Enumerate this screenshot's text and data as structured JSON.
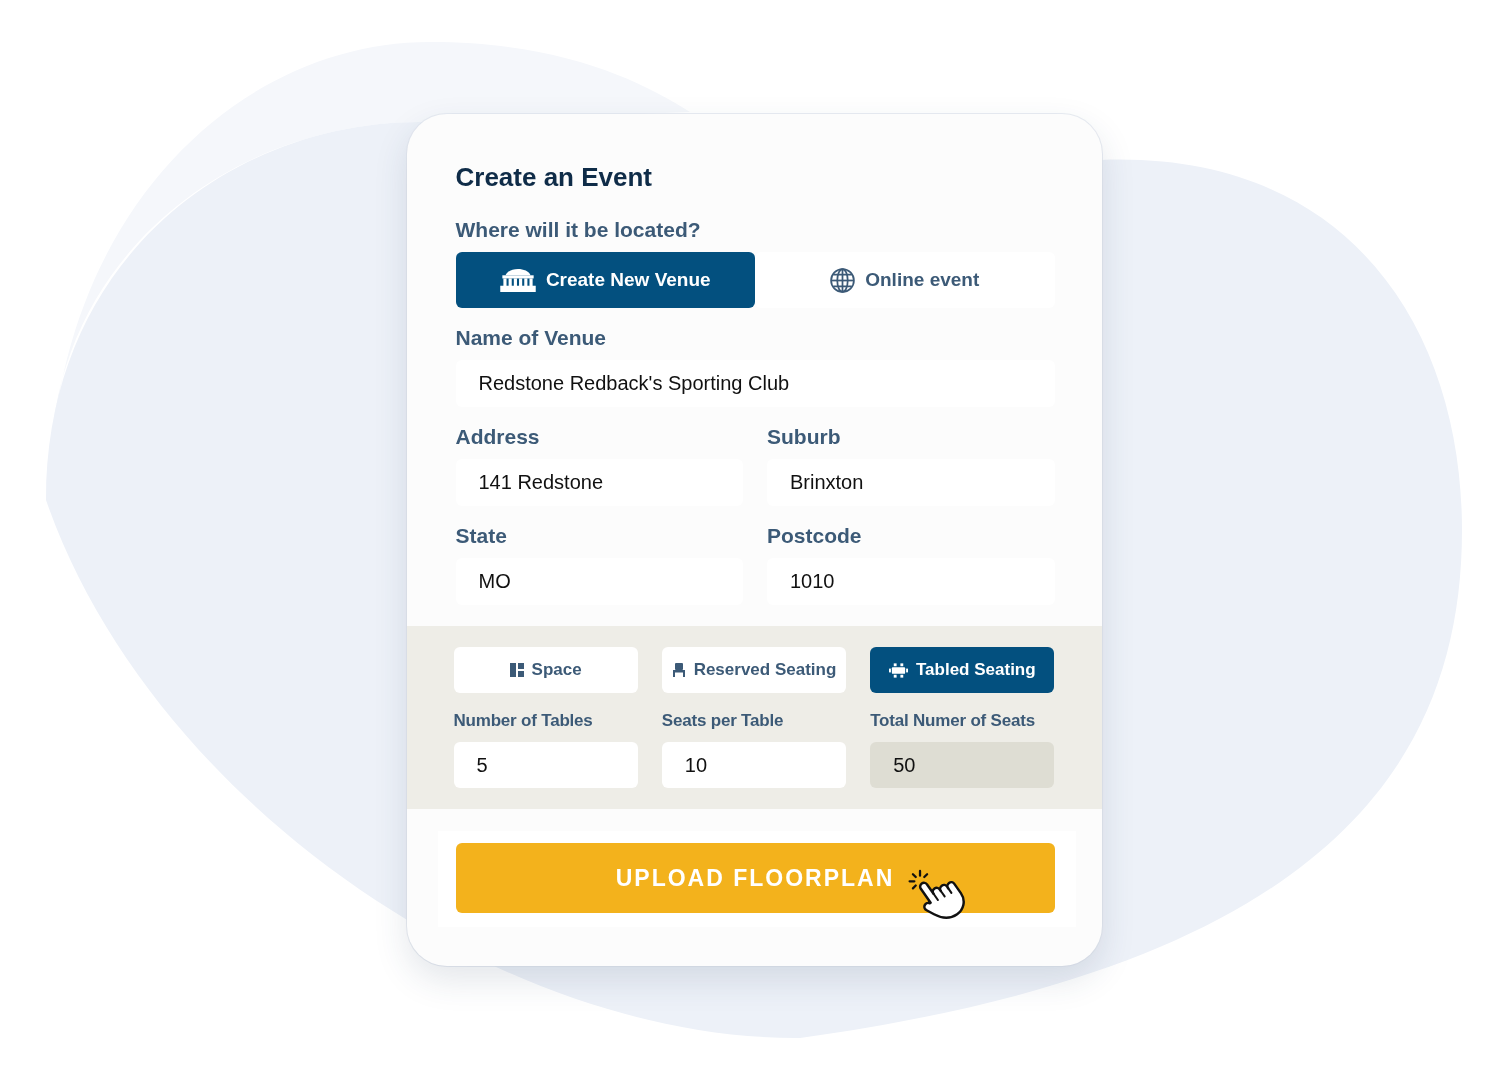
{
  "form": {
    "title": "Create an Event",
    "location_question": "Where will it be located?",
    "location_options": [
      {
        "label": "Create New Venue",
        "selected": true
      },
      {
        "label": "Online event",
        "selected": false
      }
    ],
    "venue_name": {
      "label": "Name of Venue",
      "value": "Redstone Redback's Sporting Club"
    },
    "address_fields": [
      {
        "label": "Address",
        "value": "141 Redstone"
      },
      {
        "label": "Suburb",
        "value": "Brinxton"
      },
      {
        "label": "State",
        "value": "MO"
      },
      {
        "label": "Postcode",
        "value": "1010"
      }
    ],
    "seating_types": [
      {
        "label": "Space",
        "selected": false
      },
      {
        "label": "Reserved Seating",
        "selected": false
      },
      {
        "label": "Tabled Seating",
        "selected": true
      }
    ],
    "seating_fields": [
      {
        "label": "Number of Tables",
        "value": "5",
        "disabled": false
      },
      {
        "label": "Seats per Table",
        "value": "10",
        "disabled": false
      },
      {
        "label": "Total Numer of Seats",
        "value": "50",
        "disabled": true
      }
    ],
    "upload_button": {
      "label": "UPLOAD FLOORPLAN"
    }
  }
}
